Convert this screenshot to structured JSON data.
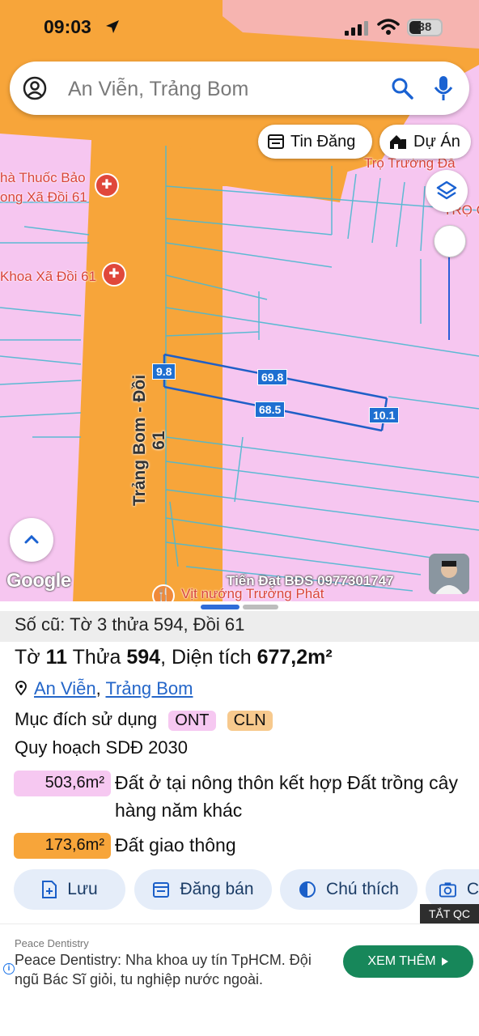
{
  "status_bar": {
    "time": "09:03",
    "battery": "38"
  },
  "search": {
    "text": "An Viễn, Trảng Bom"
  },
  "chips": {
    "tin_dang": "Tin Đăng",
    "du_an": "Dự Án"
  },
  "map": {
    "labels": {
      "pharmacy_1": "hà Thuốc Bảo",
      "pharmacy_2": "ong Xã Đồi 61",
      "clinic": "Khoa Xã Đồi 61",
      "tro": "Trọ Trường Đă",
      "tro_short": "TRỌ C",
      "road": "Trảng Bom - Đồi 61",
      "restaurant": "Vịt nướng Trường Phát"
    },
    "dimensions": {
      "left": "9.8",
      "top": "69.8",
      "bottom": "68.5",
      "right": "10.1"
    },
    "google": "Google",
    "watermark": "Tiến Đạt BĐS 0977301747"
  },
  "sheet": {
    "old_info": "Số cũ: Tờ 3 thửa 594, Đồi 61",
    "to_label": "Tờ",
    "to_value": "11",
    "thua_label": "Thửa",
    "thua_value": "594",
    "dien_tich_label": "Diện tích",
    "dien_tich_value": "677,2m²",
    "location_1": "An Viễn",
    "location_2": "Trảng Bom",
    "purpose_label": "Mục đích sử dụng",
    "purpose_codes": [
      "ONT",
      "CLN"
    ],
    "planning_title": "Quy hoạch SDĐ 2030",
    "planning": [
      {
        "area": "503,6m²",
        "desc": "Đất ở tại nông thôn kết hợp Đất trồng cây hàng năm khác",
        "color": "#f6c8f1"
      },
      {
        "area": "173,6m²",
        "desc": "Đất giao thông",
        "color": "#f7a53a"
      }
    ]
  },
  "actions": {
    "luu": "Lưu",
    "dang_ban": "Đăng bán",
    "chu_thich": "Chú thích",
    "camera": "C"
  },
  "ad_label": "TẮT QC",
  "ad": {
    "source": "Peace Dentistry",
    "text": "Peace Dentistry: Nha khoa uy tín TpHCM. Đội ngũ Bác Sĩ giỏi, tu nghiệp nước ngoài.",
    "cta": "XEM THÊM"
  }
}
